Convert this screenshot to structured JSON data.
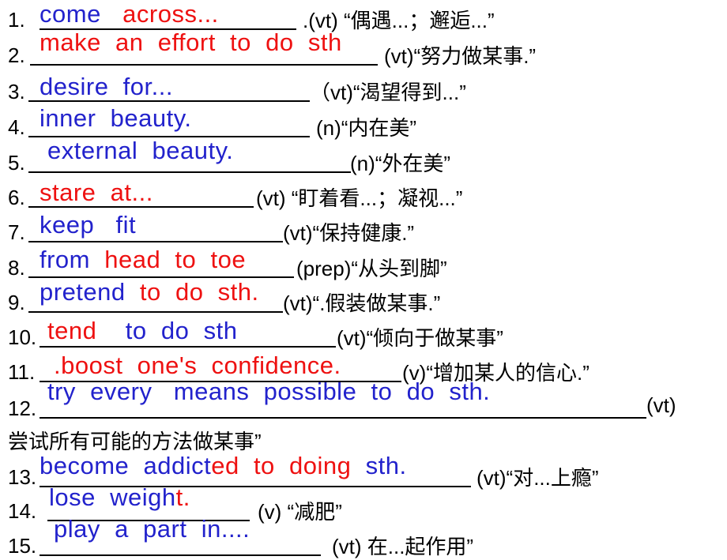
{
  "colors": {
    "blue": "#2222cc",
    "red": "#ee1111"
  },
  "items": [
    {
      "num": "1.",
      "segments": [
        {
          "text": "come   ",
          "color": "blue"
        },
        {
          "text": "across...",
          "color": "red"
        }
      ],
      "gloss": ".(vt) “偶遇...；邂逅...”"
    },
    {
      "num": "2.",
      "segments": [
        {
          "text": "make  an  effort  to  do  sth",
          "color": "red"
        }
      ],
      "gloss": "(vt)“努力做某事.”"
    },
    {
      "num": "3.",
      "segments": [
        {
          "text": "desire  for...",
          "color": "blue"
        }
      ],
      "gloss": "（vt)“渴望得到...”"
    },
    {
      "num": "4.",
      "segments": [
        {
          "text": "inner  beauty.",
          "color": "blue"
        }
      ],
      "gloss": "(n)“内在美”"
    },
    {
      "num": "5.",
      "segments": [
        {
          "text": "external  beauty.",
          "color": "blue"
        }
      ],
      "gloss": "(n)“外在美”"
    },
    {
      "num": "6.",
      "segments": [
        {
          "text": "stare  at...",
          "color": "red"
        }
      ],
      "gloss": "(vt)  “盯着看...；凝视...”"
    },
    {
      "num": "7.",
      "segments": [
        {
          "text": "keep   fit",
          "color": "blue"
        }
      ],
      "gloss": "(vt)“保持健康.”"
    },
    {
      "num": "8.",
      "segments": [
        {
          "text": "from  ",
          "color": "blue"
        },
        {
          "text": "head  to  toe",
          "color": "red"
        }
      ],
      "gloss": "(prep)“从头到脚”"
    },
    {
      "num": "9.",
      "segments": [
        {
          "text": "pretend  ",
          "color": "blue"
        },
        {
          "text": "to  do  sth.",
          "color": "red"
        }
      ],
      "gloss": "(vt)“.假装做某事.”"
    },
    {
      "num": "10.",
      "segments": [
        {
          "text": "tend    ",
          "color": "red"
        },
        {
          "text": "to  do  sth",
          "color": "blue"
        }
      ],
      "gloss": "(vt)“倾向于做某事”"
    },
    {
      "num": "11.",
      "segments": [
        {
          "text": ".boost  one's  confidence.",
          "color": "red"
        }
      ],
      "gloss": "(v)“增加某人的信心.”"
    },
    {
      "num": "12.",
      "segments": [
        {
          "text": "try  every   means  possible  ",
          "color": "blue"
        },
        {
          "text": "to  do  sth.",
          "color": "blue"
        }
      ],
      "gloss": "(vt)"
    },
    {
      "num": "",
      "segments": [],
      "gloss": "尝试所有可能的方法做某事”"
    },
    {
      "num": "13.",
      "segments": [
        {
          "text": "become  addict",
          "color": "blue"
        },
        {
          "text": "ed  to  doing",
          "color": "red"
        },
        {
          "text": "  sth.",
          "color": "blue"
        }
      ],
      "gloss": "(vt)“对...上瘾”"
    },
    {
      "num": "14.",
      "segments": [
        {
          "text": "lose  weigh",
          "color": "blue"
        },
        {
          "text": "t.",
          "color": "red"
        }
      ],
      "gloss": "(v) “减肥”"
    },
    {
      "num": "15.",
      "segments": [
        {
          "text": "play  a  part  in....",
          "color": "blue"
        }
      ],
      "gloss": "(vt)  在...起作用”"
    }
  ]
}
